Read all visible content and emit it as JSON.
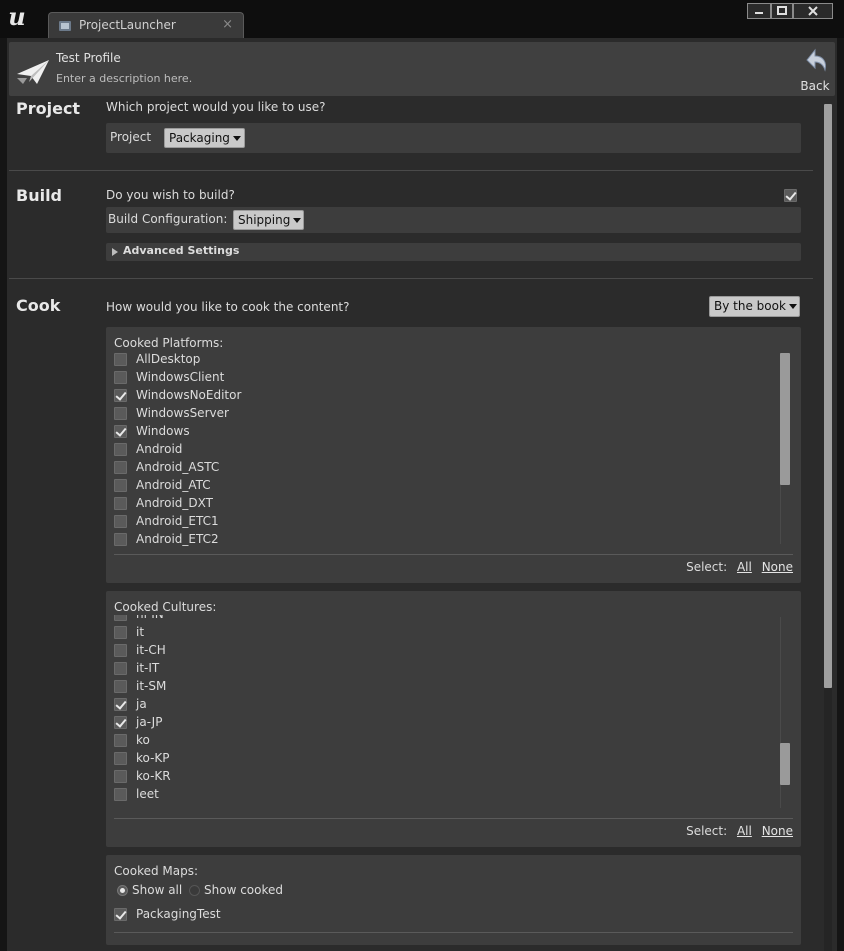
{
  "tab": {
    "label": "ProjectLauncher",
    "close": "×"
  },
  "header": {
    "title": "Test Profile",
    "description": "Enter a description here.",
    "back_label": "Back"
  },
  "project": {
    "title": "Project",
    "question": "Which project would you like to use?",
    "field_label": "Project",
    "value": "Packaging"
  },
  "build": {
    "title": "Build",
    "question": "Do you wish to build?",
    "enabled": true,
    "config_label": "Build Configuration:",
    "config_value": "Shipping",
    "advanced_label": "Advanced Settings"
  },
  "cook": {
    "title": "Cook",
    "question": "How would you like to cook the content?",
    "mode": "By the book",
    "platforms_label": "Cooked Platforms:",
    "platforms": [
      {
        "label": "AllDesktop",
        "checked": false
      },
      {
        "label": "WindowsClient",
        "checked": false
      },
      {
        "label": "WindowsNoEditor",
        "checked": true
      },
      {
        "label": "WindowsServer",
        "checked": false
      },
      {
        "label": "Windows",
        "checked": true
      },
      {
        "label": "Android",
        "checked": false
      },
      {
        "label": "Android_ASTC",
        "checked": false
      },
      {
        "label": "Android_ATC",
        "checked": false
      },
      {
        "label": "Android_DXT",
        "checked": false
      },
      {
        "label": "Android_ETC1",
        "checked": false
      },
      {
        "label": "Android_ETC2",
        "checked": false
      }
    ],
    "cultures_label": "Cooked Cultures:",
    "cultures": [
      {
        "label": "hi-IN",
        "checked": false
      },
      {
        "label": "it",
        "checked": false
      },
      {
        "label": "it-CH",
        "checked": false
      },
      {
        "label": "it-IT",
        "checked": false
      },
      {
        "label": "it-SM",
        "checked": false
      },
      {
        "label": "ja",
        "checked": true
      },
      {
        "label": "ja-JP",
        "checked": true
      },
      {
        "label": "ko",
        "checked": false
      },
      {
        "label": "ko-KP",
        "checked": false
      },
      {
        "label": "ko-KR",
        "checked": false
      },
      {
        "label": "leet",
        "checked": false
      }
    ],
    "select_label": "Select:",
    "select_all": "All",
    "select_none": "None",
    "maps_label": "Cooked Maps:",
    "show_all": "Show all",
    "show_cooked": "Show cooked",
    "maps": [
      {
        "label": "PackagingTest",
        "checked": true
      }
    ]
  }
}
